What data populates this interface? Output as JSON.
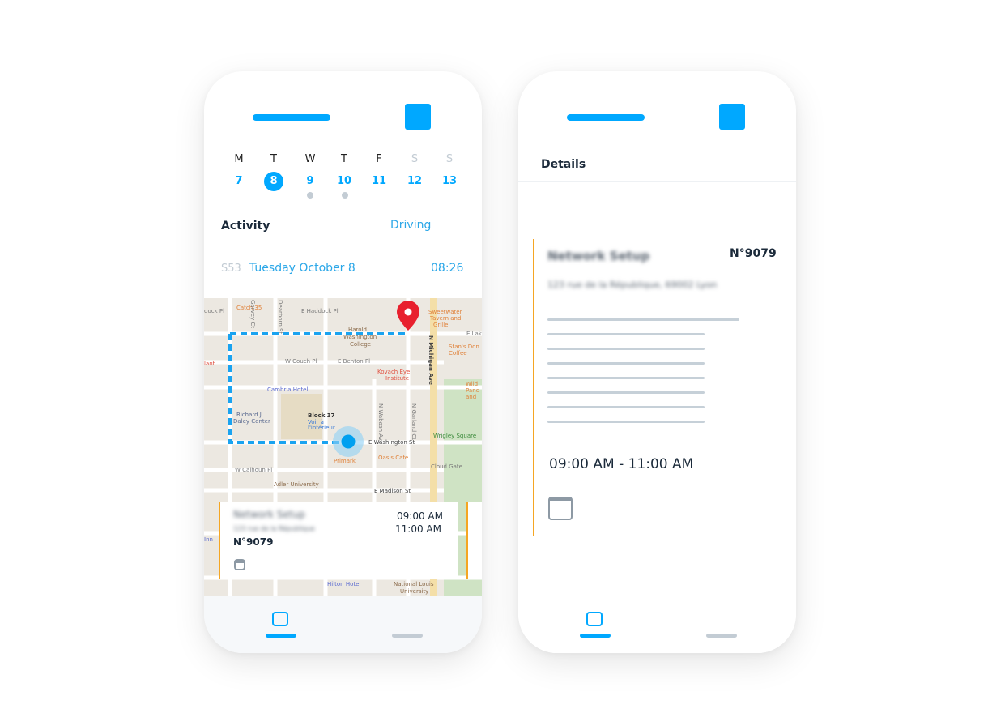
{
  "colors": {
    "accent": "#00a8ff",
    "card_border": "#f5a623",
    "pin": "#e8202e",
    "muted": "#c3ccd4"
  },
  "left_phone": {
    "week": [
      {
        "day": "M",
        "date": "7"
      },
      {
        "day": "T",
        "date": "8",
        "selected": true
      },
      {
        "day": "W",
        "date": "9",
        "has_event": true
      },
      {
        "day": "T",
        "date": "10",
        "has_event": true
      },
      {
        "day": "F",
        "date": "11"
      },
      {
        "day": "S",
        "date": "12",
        "weekend": true
      },
      {
        "day": "S",
        "date": "13",
        "weekend": true
      }
    ],
    "activity_label": "Activity",
    "driving_label": "Driving",
    "entry": {
      "code": "S53",
      "date": "Tuesday October 8",
      "time": "08:26"
    },
    "map": {
      "labels": {
        "catch35": "Catch 35",
        "haddock": "E Haddock Pl",
        "harold1": "Harold",
        "harold2": "Washington",
        "harold3": "College",
        "sweet1": "Sweetwater",
        "sweet2": "Tavern and",
        "sweet3": "Grille",
        "lake": "E Lake",
        "couch": "W Couch Pl",
        "benton": "E Benton Pl",
        "stans1": "Stan's Don",
        "stans2": "Coffee",
        "kovach1": "Kovach Eye",
        "kovach2": "Institute",
        "cambria": "Cambria Hotel",
        "daley1": "Richard J.",
        "daley2": "Daley Center",
        "block37": "Block 37",
        "voir1": "Voir à",
        "voir2": "l'intérieur",
        "washington": "E Washington St",
        "wabash": "N Wabash Ave",
        "garland": "N Garland Ct",
        "michigan": "N Michigan Ave",
        "wrigley": "Wrigley Square",
        "primark": "Primark",
        "oasis": "Oasis Cafe",
        "cloudgate": "Cloud Gate",
        "calhoun": "W Calhoun Pl",
        "adler": "Adler University",
        "madison": "E Madison St",
        "wild1": "Wild",
        "wild2": "Panc",
        "wild3": "and",
        "dock": "dock Pl",
        "garvey": "Garvey Ct",
        "dearborn": "Dearborn St",
        "hilton": "Hilton Hotel",
        "nlu1": "National Louis",
        "nlu2": "University",
        "inn": "Inn",
        "lant": "lant"
      }
    },
    "card": {
      "title": "Network Setup",
      "address": "123 rue de la République",
      "number": "N°9079",
      "start": "09:00 AM",
      "end": "11:00 AM"
    }
  },
  "right_phone": {
    "header": "Details",
    "card": {
      "title": "Network Setup",
      "number": "N°9079",
      "address": "123 rue de la République, 69002 Lyon",
      "time_range": "09:00 AM - 11:00 AM"
    }
  }
}
